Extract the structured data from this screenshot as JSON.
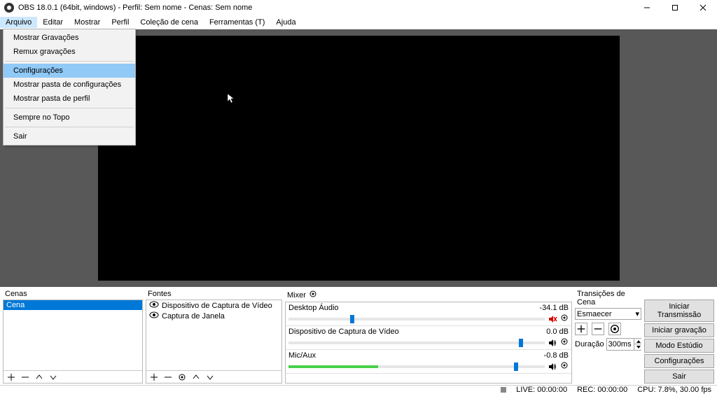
{
  "window": {
    "title": "OBS 18.0.1 (64bit, windows) - Perfil: Sem nome - Cenas: Sem nome"
  },
  "menubar": {
    "items": [
      "Arquivo",
      "Editar",
      "Mostrar",
      "Perfil",
      "Coleção de cena",
      "Ferramentas (T)",
      "Ajuda"
    ],
    "active_index": 0
  },
  "dropdown": {
    "items": [
      {
        "label": "Mostrar Gravações"
      },
      {
        "label": "Remux gravações"
      },
      {
        "sep": true
      },
      {
        "label": "Configurações",
        "highlight": true
      },
      {
        "label": "Mostrar pasta de configurações"
      },
      {
        "label": "Mostrar pasta de perfil"
      },
      {
        "sep": true
      },
      {
        "label": "Sempre no Topo"
      },
      {
        "sep": true
      },
      {
        "label": "Sair"
      }
    ]
  },
  "panel_labels": {
    "cenas": "Cenas",
    "fontes": "Fontes",
    "mixer": "Mixer",
    "transicoes": "Transições de Cena"
  },
  "cenas": {
    "items": [
      {
        "label": "Cena",
        "selected": true
      }
    ]
  },
  "fontes": {
    "items": [
      {
        "label": "Dispositivo de Captura de Vídeo"
      },
      {
        "label": "Captura de Janela"
      }
    ]
  },
  "mixer": {
    "entries": [
      {
        "name": "Desktop Áudio",
        "db": "-34.1 dB",
        "fill_pct": 0,
        "handle_pct": 24,
        "muted": true
      },
      {
        "name": "Dispositivo de Captura de Vídeo",
        "db": "0.0 dB",
        "fill_pct": 0,
        "handle_pct": 90,
        "muted": false
      },
      {
        "name": "Mic/Aux",
        "db": "-0.8 dB",
        "fill_pct": 35,
        "handle_pct": 88,
        "muted": false
      }
    ]
  },
  "transicoes": {
    "selected": "Esmaecer",
    "duracao_label": "Duração",
    "duracao_value": "300ms"
  },
  "actions": {
    "buttons": [
      "Iniciar Transmissão",
      "Iniciar gravação",
      "Modo Estúdio",
      "Configurações",
      "Sair"
    ]
  },
  "statusbar": {
    "live": "LIVE: 00:00:00",
    "rec": "REC: 00:00:00",
    "cpu": "CPU: 7.8%, 30.00 fps"
  }
}
